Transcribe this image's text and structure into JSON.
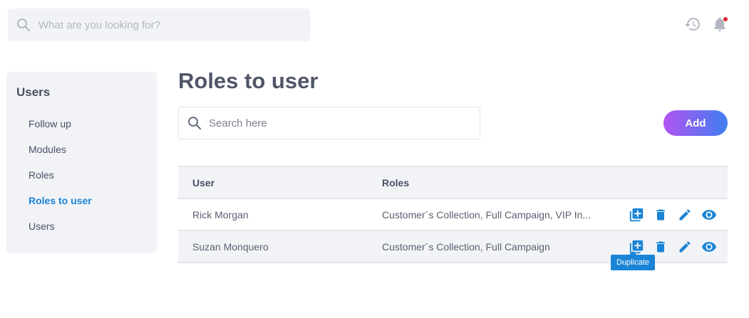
{
  "top_search": {
    "placeholder": "What are you looking for?"
  },
  "header_icons": [
    "history-icon",
    "notifications-bell-icon"
  ],
  "sidebar": {
    "title": "Users",
    "items": [
      {
        "label": "Follow up",
        "active": false
      },
      {
        "label": "Modules",
        "active": false
      },
      {
        "label": "Roles",
        "active": false
      },
      {
        "label": "Roles to user",
        "active": true
      },
      {
        "label": "Users",
        "active": false
      }
    ]
  },
  "main": {
    "title": "Roles to user",
    "search": {
      "placeholder": "Search here"
    },
    "add_label": "Add"
  },
  "table": {
    "columns": [
      "User",
      "Roles"
    ],
    "rows": [
      {
        "user": "Rick Morgan",
        "roles": "Customer´s Collection, Full Campaign, VIP In..."
      },
      {
        "user": "Suzan Monquero",
        "roles": "Customer´s Collection, Full Campaign"
      }
    ],
    "row_actions": [
      "duplicate-icon",
      "delete-icon",
      "edit-icon",
      "view-icon"
    ]
  },
  "tooltip": {
    "text": "Duplicate"
  },
  "colors": {
    "accent": "#1a84d6",
    "gradient_start": "#b252f3",
    "gradient_end": "#3f7ff0",
    "panel": "#f2f3f7",
    "notification_dot": "#e0242f"
  }
}
